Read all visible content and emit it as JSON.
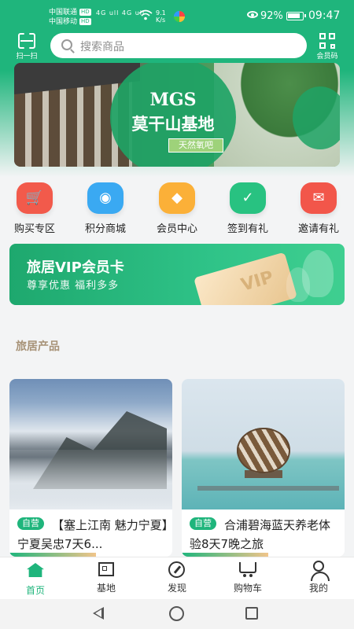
{
  "status_bar": {
    "carrier1": "中国联通",
    "carrier2": "中国移动",
    "hd_badge": "HD",
    "signal": "4G ull 4G ull",
    "net_speed_value": "9.1",
    "net_speed_unit": "K/s",
    "battery": "92%",
    "time": "09:47"
  },
  "header": {
    "scan_label": "扫一扫",
    "search_placeholder": "搜索商品",
    "member_code_label": "会员码"
  },
  "banner": {
    "title_line1": "MGS",
    "title_line2": "莫干山基地",
    "tag": "天然氧吧"
  },
  "quick_menu": [
    {
      "label": "购买专区",
      "icon": "cart-icon",
      "color": "#f25a4b",
      "glyph": "🛒"
    },
    {
      "label": "积分商城",
      "icon": "points-icon",
      "color": "#3aa9f2",
      "glyph": "◉"
    },
    {
      "label": "会员中心",
      "icon": "member-diamond-icon",
      "color": "#fbb038",
      "glyph": "◆"
    },
    {
      "label": "签到有礼",
      "icon": "checkin-calendar-icon",
      "color": "#28c281",
      "glyph": "✓"
    },
    {
      "label": "邀请有礼",
      "icon": "invite-gift-icon",
      "color": "#f2564a",
      "glyph": "✉"
    }
  ],
  "vip_card": {
    "title": "旅居VIP会员卡",
    "subtitle": "尊享优惠 福利多多",
    "card_text": "VIP"
  },
  "section": {
    "title": "旅居产品"
  },
  "products": [
    {
      "tag": "自营",
      "title": "【塞上江南 魅力宁夏】宁夏吴忠7天6..."
    },
    {
      "tag": "自营",
      "title": "合浦碧海蓝天养老体验8天7晚之旅"
    }
  ],
  "tabbar": [
    {
      "label": "首页",
      "active": true
    },
    {
      "label": "基地",
      "active": false
    },
    {
      "label": "发现",
      "active": false
    },
    {
      "label": "购物车",
      "active": false
    },
    {
      "label": "我的",
      "active": false
    }
  ],
  "colors": {
    "brand_green": "#1fb57c",
    "section_title": "#a79277"
  }
}
